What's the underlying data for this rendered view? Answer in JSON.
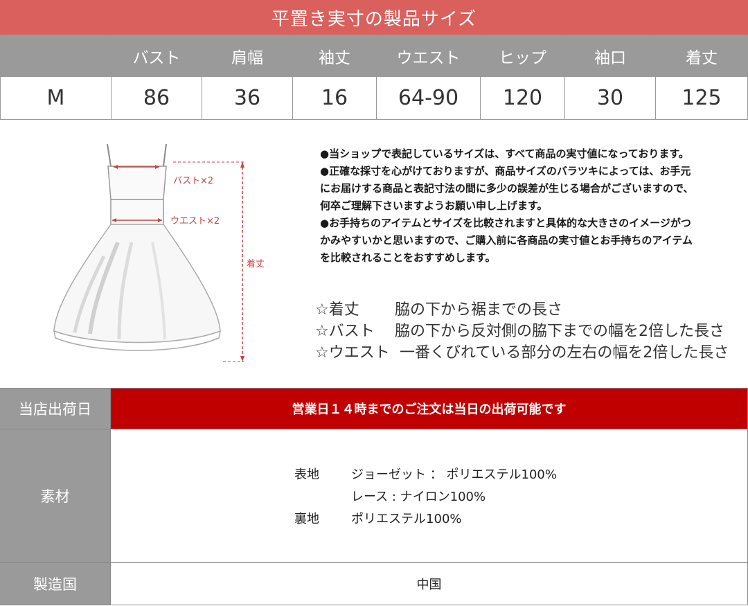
{
  "banner": "平置き実寸の製品サイズ",
  "size_table": {
    "headers": [
      "",
      "バスト",
      "肩幅",
      "袖丈",
      "ウエスト",
      "ヒップ",
      "袖口",
      "着丈"
    ],
    "row": [
      "M",
      "86",
      "36",
      "16",
      "64-90",
      "120",
      "30",
      "125"
    ]
  },
  "figure": {
    "bust_label": "バスト×2",
    "waist_label": "ウエスト×2",
    "length_label": "着丈"
  },
  "notes": [
    "●当ショップで表記しているサイズは、すべて商品の実寸値になっております。",
    "●正確な採寸を心がけておりますが、商品サイズのバラツキによっては、お手元",
    "にお届けする商品と表記寸法の間に多少の誤差が生じる場合がございますので、",
    "何卒ご理解下さいますようお願い申し上げます。",
    "●お手持ちのアイテムとサイズを比較されますと具体的な大きさのイメージがつ",
    "かみやすいかと思いますので、ご購入前に各商品の実寸値とお手持ちのアイテム",
    "を比較されることをおすすめします。"
  ],
  "definitions": [
    {
      "term": "☆着丈",
      "desc": "脇の下から裾までの長さ"
    },
    {
      "term": "☆バスト",
      "desc": "脇の下から反対側の脇下までの幅を2倍した長さ"
    },
    {
      "term": "☆ウエスト",
      "desc": "一番くびれている部分の左右の幅を2倍した長さ"
    }
  ],
  "shipping": {
    "label": "当店出荷日",
    "value": "営業日１４時までのご注文は当日の出荷可能です"
  },
  "material": {
    "label": "素材",
    "outer_label": "表地",
    "outer_1": "ジョーゼット ： ポリエステル100%",
    "outer_2": "レース : ナイロン100%",
    "lining_label": "裏地",
    "lining": "ポリエステル100%"
  },
  "origin": {
    "label": "製造国",
    "value": "中国"
  },
  "colors": {
    "banner": "#d9605c",
    "header_gray": "#9a9a9a",
    "shipping_red": "#c00000"
  }
}
